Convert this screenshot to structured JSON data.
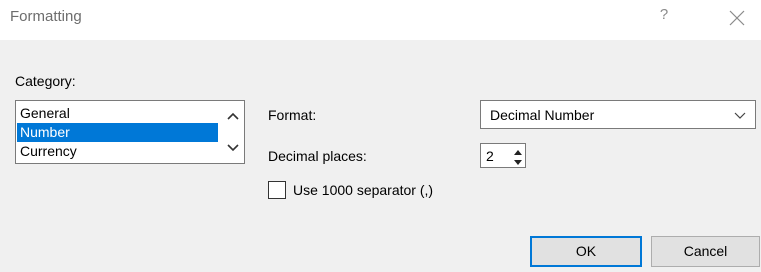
{
  "dialog": {
    "title": "Formatting",
    "help_glyph": "?",
    "close_icon": "close-icon"
  },
  "category": {
    "label": "Category:",
    "items": [
      {
        "label": "General",
        "selected": false
      },
      {
        "label": "Number",
        "selected": true
      },
      {
        "label": "Currency",
        "selected": false
      }
    ],
    "scroll_up_icon": "chevron-up-icon",
    "scroll_down_icon": "chevron-down-icon"
  },
  "format": {
    "label": "Format:",
    "selected_value": "Decimal Number",
    "dropdown_icon": "chevron-down-icon"
  },
  "decimal_places": {
    "label": "Decimal places:",
    "value": "2"
  },
  "separator": {
    "label": "Use 1000 separator (,)",
    "checked": false
  },
  "buttons": {
    "ok_label": "OK",
    "cancel_label": "Cancel"
  },
  "colors": {
    "selection": "#0078d7",
    "dialog_bg": "#f0f0f0",
    "titlebar_bg": "#ffffff",
    "default_button_border": "#0078d7"
  }
}
